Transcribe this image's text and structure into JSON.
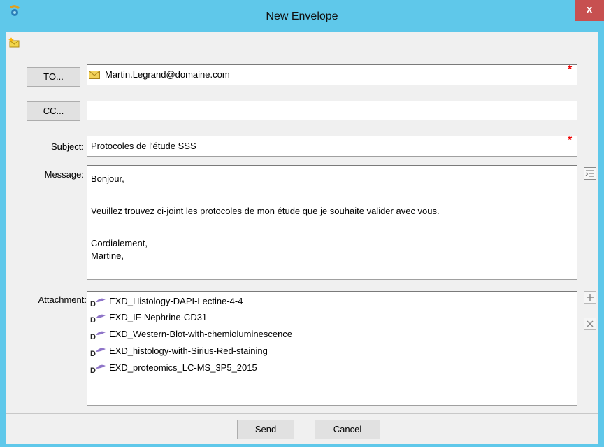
{
  "window": {
    "title": "New Envelope",
    "close_label": "x"
  },
  "form": {
    "to_button": "TO...",
    "to_value": "Martin.Legrand@domaine.com",
    "cc_button": "CC...",
    "cc_value": "",
    "subject_label": "Subject:",
    "subject_value": "Protocoles de l'étude SSS",
    "message_label": "Message:",
    "message_lines": [
      "Bonjour,",
      "Veuillez trouvez ci-joint les protocoles de mon étude que je souhaite valider avec vous.",
      "Cordialement,",
      "Martine,"
    ],
    "attachment_label": "Attachment:",
    "attachments": [
      "EXD_Histology-DAPI-Lectine-4-4",
      "EXD_IF-Nephrine-CD31",
      "EXD_Western-Blot-with-chemioluminescence",
      "EXD_histology-with-Sirius-Red-staining",
      "EXD_proteomics_LC-MS_3P5_2015"
    ],
    "required_marker": "*"
  },
  "buttons": {
    "send": "Send",
    "cancel": "Cancel"
  },
  "colors": {
    "titlebar": "#5fc8ea",
    "close": "#c75050",
    "required": "#e00000",
    "dialog_bg": "#f0f0f0"
  },
  "icons": [
    "app-logo-icon",
    "new-envelope-icon",
    "envelope-icon",
    "format-icon",
    "document-icon",
    "add-icon",
    "remove-icon"
  ]
}
